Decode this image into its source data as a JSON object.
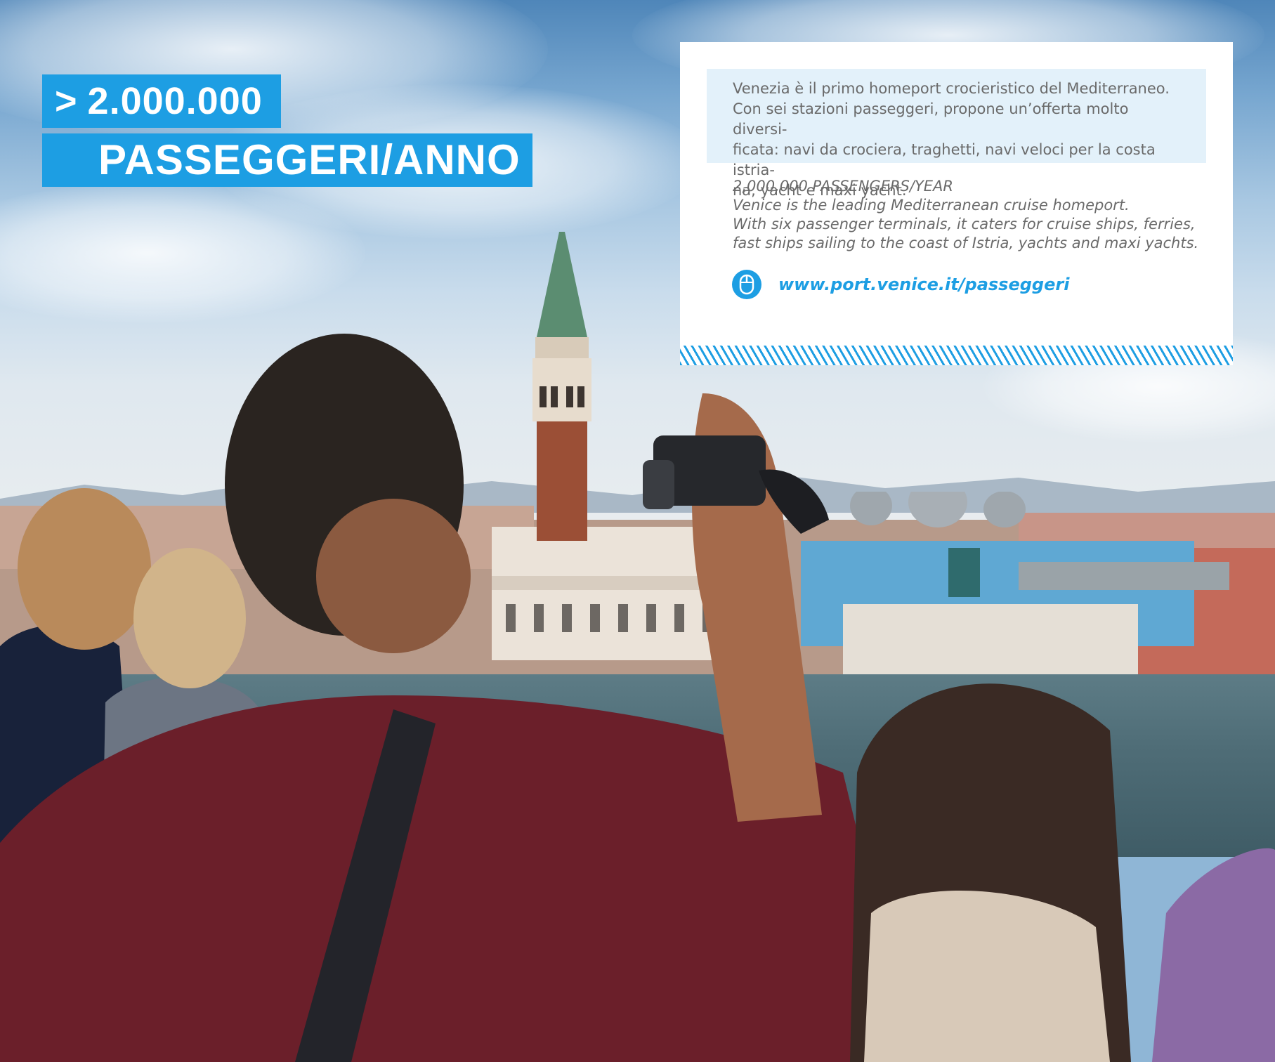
{
  "headline": {
    "prefix": ">",
    "number": "2.000.000",
    "label": "PASSEGGERI/ANNO"
  },
  "panel": {
    "italian_lines": [
      "Venezia è il primo homeport crocieristico del Mediterraneo.",
      "Con sei stazioni passeggeri, propone un’offerta molto diversi-",
      "ficata: navi da crociera, traghetti, navi veloci per la costa istria-",
      "na, yacht e maxi yacht."
    ],
    "english_lines": [
      "2,000,000 PASSENGERS/YEAR",
      "Venice is the leading Mediterranean cruise homeport.",
      "With six passenger terminals, it caters for cruise ships, ferries,",
      "fast ships sailing to the coast of Istria, yachts and maxi yachts."
    ],
    "link_icon": "mouse-icon",
    "link_text": "www.port.venice.it/passeggeri"
  },
  "colors": {
    "accent": "#1d9ee3",
    "panel_tint": "#e3f1fa",
    "body_text": "#6a6a6a"
  }
}
